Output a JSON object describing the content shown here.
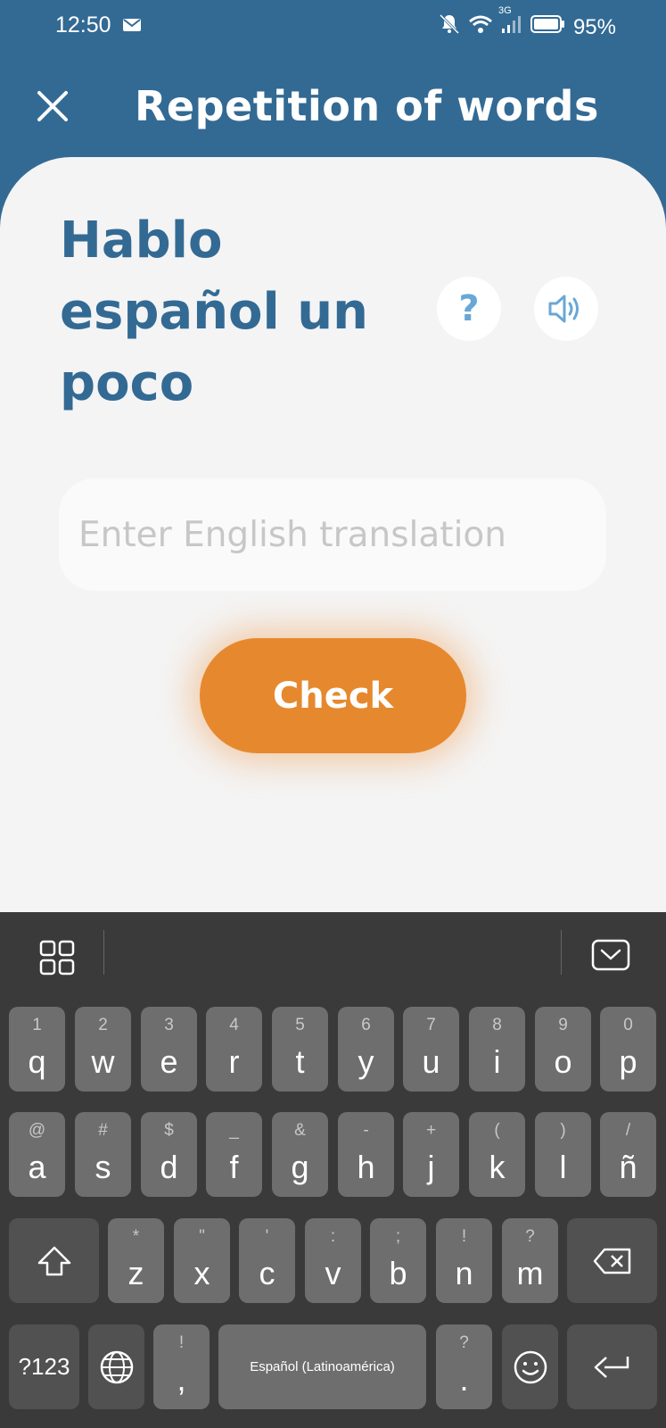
{
  "status_bar": {
    "time": "12:50",
    "battery": "95%",
    "network": "3G"
  },
  "header": {
    "title": "Repetition of words"
  },
  "card": {
    "phrase_lines": [
      "Hablo",
      "español un",
      "poco"
    ],
    "hint_symbol": "?",
    "answer_placeholder": "Enter English translation",
    "check_label": "Check"
  },
  "keyboard": {
    "row1": [
      {
        "sub": "1",
        "main": "q"
      },
      {
        "sub": "2",
        "main": "w"
      },
      {
        "sub": "3",
        "main": "e"
      },
      {
        "sub": "4",
        "main": "r"
      },
      {
        "sub": "5",
        "main": "t"
      },
      {
        "sub": "6",
        "main": "y"
      },
      {
        "sub": "7",
        "main": "u"
      },
      {
        "sub": "8",
        "main": "i"
      },
      {
        "sub": "9",
        "main": "o"
      },
      {
        "sub": "0",
        "main": "p"
      }
    ],
    "row2": [
      {
        "sub": "@",
        "main": "a"
      },
      {
        "sub": "#",
        "main": "s"
      },
      {
        "sub": "$",
        "main": "d"
      },
      {
        "sub": "_",
        "main": "f"
      },
      {
        "sub": "&",
        "main": "g"
      },
      {
        "sub": "-",
        "main": "h"
      },
      {
        "sub": "+",
        "main": "j"
      },
      {
        "sub": "(",
        "main": "k"
      },
      {
        "sub": ")",
        "main": "l"
      },
      {
        "sub": "/",
        "main": "ñ"
      }
    ],
    "row3": [
      {
        "sub": "*",
        "main": "z"
      },
      {
        "sub": "\"",
        "main": "x"
      },
      {
        "sub": "'",
        "main": "c"
      },
      {
        "sub": ":",
        "main": "v"
      },
      {
        "sub": ";",
        "main": "b"
      },
      {
        "sub": "!",
        "main": "n"
      },
      {
        "sub": "?",
        "main": "m"
      }
    ],
    "symbols_label": "?123",
    "comma": {
      "sub": "!",
      "main": ","
    },
    "space_label": "Español (Latinoamérica)",
    "period": {
      "sub": "?",
      "main": "."
    }
  },
  "colors": {
    "primary": "#336a94",
    "accent": "#e6892e",
    "card_bg": "#f4f4f4",
    "keyboard_bg": "#3a3a3a"
  }
}
